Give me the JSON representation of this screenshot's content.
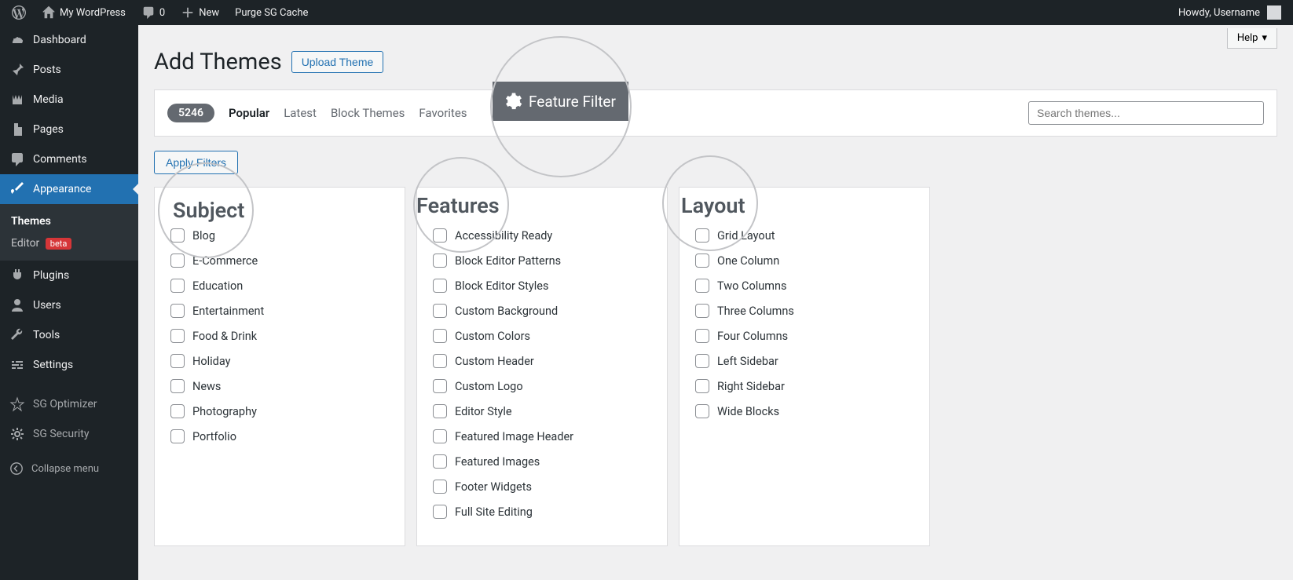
{
  "toolbar": {
    "site_name": "My WordPress",
    "comments_count": "0",
    "new_label": "New",
    "purge_label": "Purge SG Cache",
    "howdy": "Howdy, Username"
  },
  "sidebar": {
    "dashboard": "Dashboard",
    "posts": "Posts",
    "media": "Media",
    "pages": "Pages",
    "comments": "Comments",
    "appearance": "Appearance",
    "themes": "Themes",
    "editor": "Editor",
    "editor_badge": "beta",
    "plugins": "Plugins",
    "users": "Users",
    "tools": "Tools",
    "settings": "Settings",
    "sg_optimizer": "SG Optimizer",
    "sg_security": "SG Security",
    "collapse": "Collapse menu"
  },
  "help_label": "Help",
  "page_title": "Add Themes",
  "upload_label": "Upload Theme",
  "filter_bar": {
    "count": "5246",
    "popular": "Popular",
    "latest": "Latest",
    "block_themes": "Block Themes",
    "favorites": "Favorites",
    "feature_filter": "Feature Filter",
    "search_placeholder": "Search themes..."
  },
  "apply_filters": "Apply Filters",
  "col_titles": {
    "subject": "Subject",
    "features": "Features",
    "layout": "Layout"
  },
  "subject": [
    "Blog",
    "E-Commerce",
    "Education",
    "Entertainment",
    "Food & Drink",
    "Holiday",
    "News",
    "Photography",
    "Portfolio"
  ],
  "features": [
    "Accessibility Ready",
    "Block Editor Patterns",
    "Block Editor Styles",
    "Custom Background",
    "Custom Colors",
    "Custom Header",
    "Custom Logo",
    "Editor Style",
    "Featured Image Header",
    "Featured Images",
    "Footer Widgets",
    "Full Site Editing"
  ],
  "layout": [
    "Grid Layout",
    "One Column",
    "Two Columns",
    "Three Columns",
    "Four Columns",
    "Left Sidebar",
    "Right Sidebar",
    "Wide Blocks"
  ]
}
